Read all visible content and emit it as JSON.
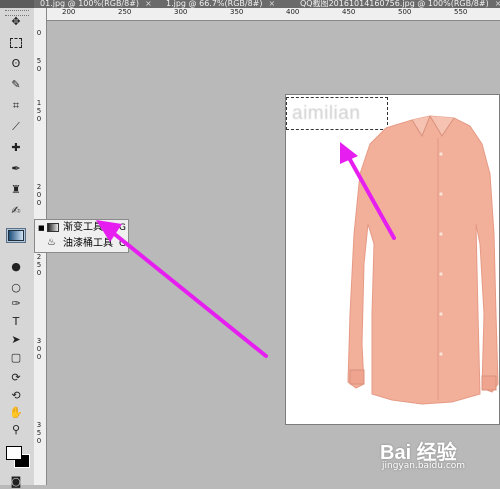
{
  "tabs": [
    {
      "label": "01.jpg @ 100%(RGB/8#)",
      "close": "×"
    },
    {
      "label": "1.jpg @ 66.7%(RGB/8#)",
      "close": "×"
    },
    {
      "label": "QQ截图20161014160756.jpg @ 100%(RGB/8#)",
      "close": "×"
    }
  ],
  "ruler_top": [
    "200",
    "250",
    "300",
    "350",
    "400",
    "450",
    "500",
    "550"
  ],
  "ruler_left": [
    "0",
    "5",
    "0",
    "1",
    "5",
    "0",
    "2",
    "0",
    "0",
    "2",
    "5",
    "0",
    "3",
    "0",
    "0",
    "3",
    "5",
    "0"
  ],
  "flyout": {
    "items": [
      {
        "label": "渐变工具",
        "shortcut": "G",
        "icon": "gradient-icon",
        "selected": true
      },
      {
        "label": "油漆桶工具",
        "shortcut": "G",
        "icon": "paint-bucket-icon",
        "selected": false
      }
    ]
  },
  "canvas": {
    "watermark_text": "aimilian"
  },
  "baidu": {
    "logo": "Bai 经验",
    "url": "jingyan.baidu.com"
  },
  "colors": {
    "arrow": "#e61ef0",
    "shirt": "#f2b09b",
    "foreground": "#ffffff",
    "background": "#000000"
  }
}
